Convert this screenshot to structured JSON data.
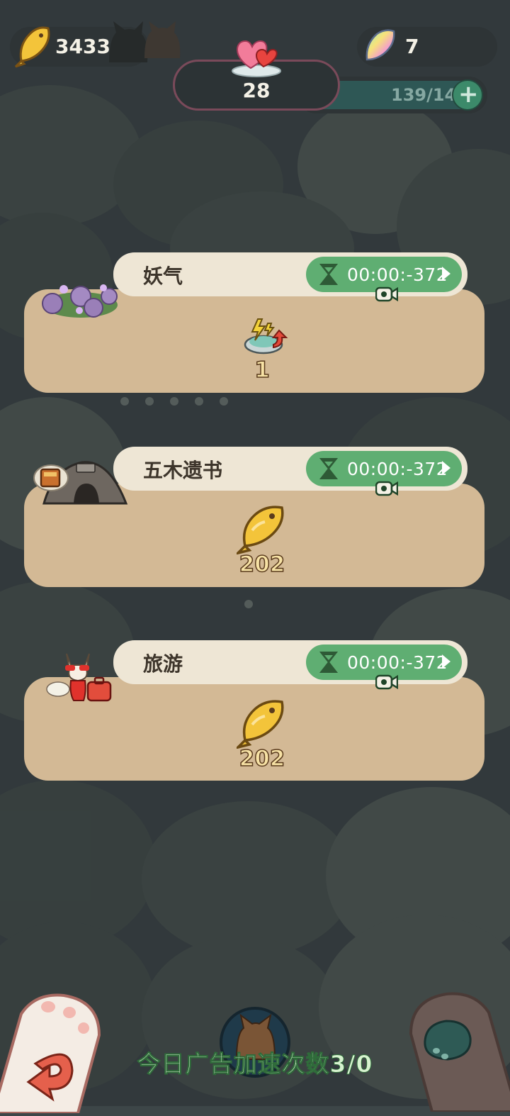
{
  "hud": {
    "fish_count": "3433",
    "gem_count": "7",
    "hearts_count": "28",
    "energy": "139/141"
  },
  "tasks": [
    {
      "title": "妖气",
      "timer": "00:00:-372",
      "reward": "1",
      "reward_icon": "speedup-icon"
    },
    {
      "title": "五木遗书",
      "timer": "00:00:-372",
      "reward": "202",
      "reward_icon": "fish-icon"
    },
    {
      "title": "旅游",
      "timer": "00:00:-372",
      "reward": "202",
      "reward_icon": "fish-icon"
    }
  ],
  "footer": {
    "ad_speedup_text": "今日广告加速次数3/0"
  },
  "colors": {
    "card": "#d3b995",
    "tab": "#eee6d5",
    "timer": "#5fae72",
    "background": "#3d4648",
    "bottom_text": "#d7f2cf"
  }
}
